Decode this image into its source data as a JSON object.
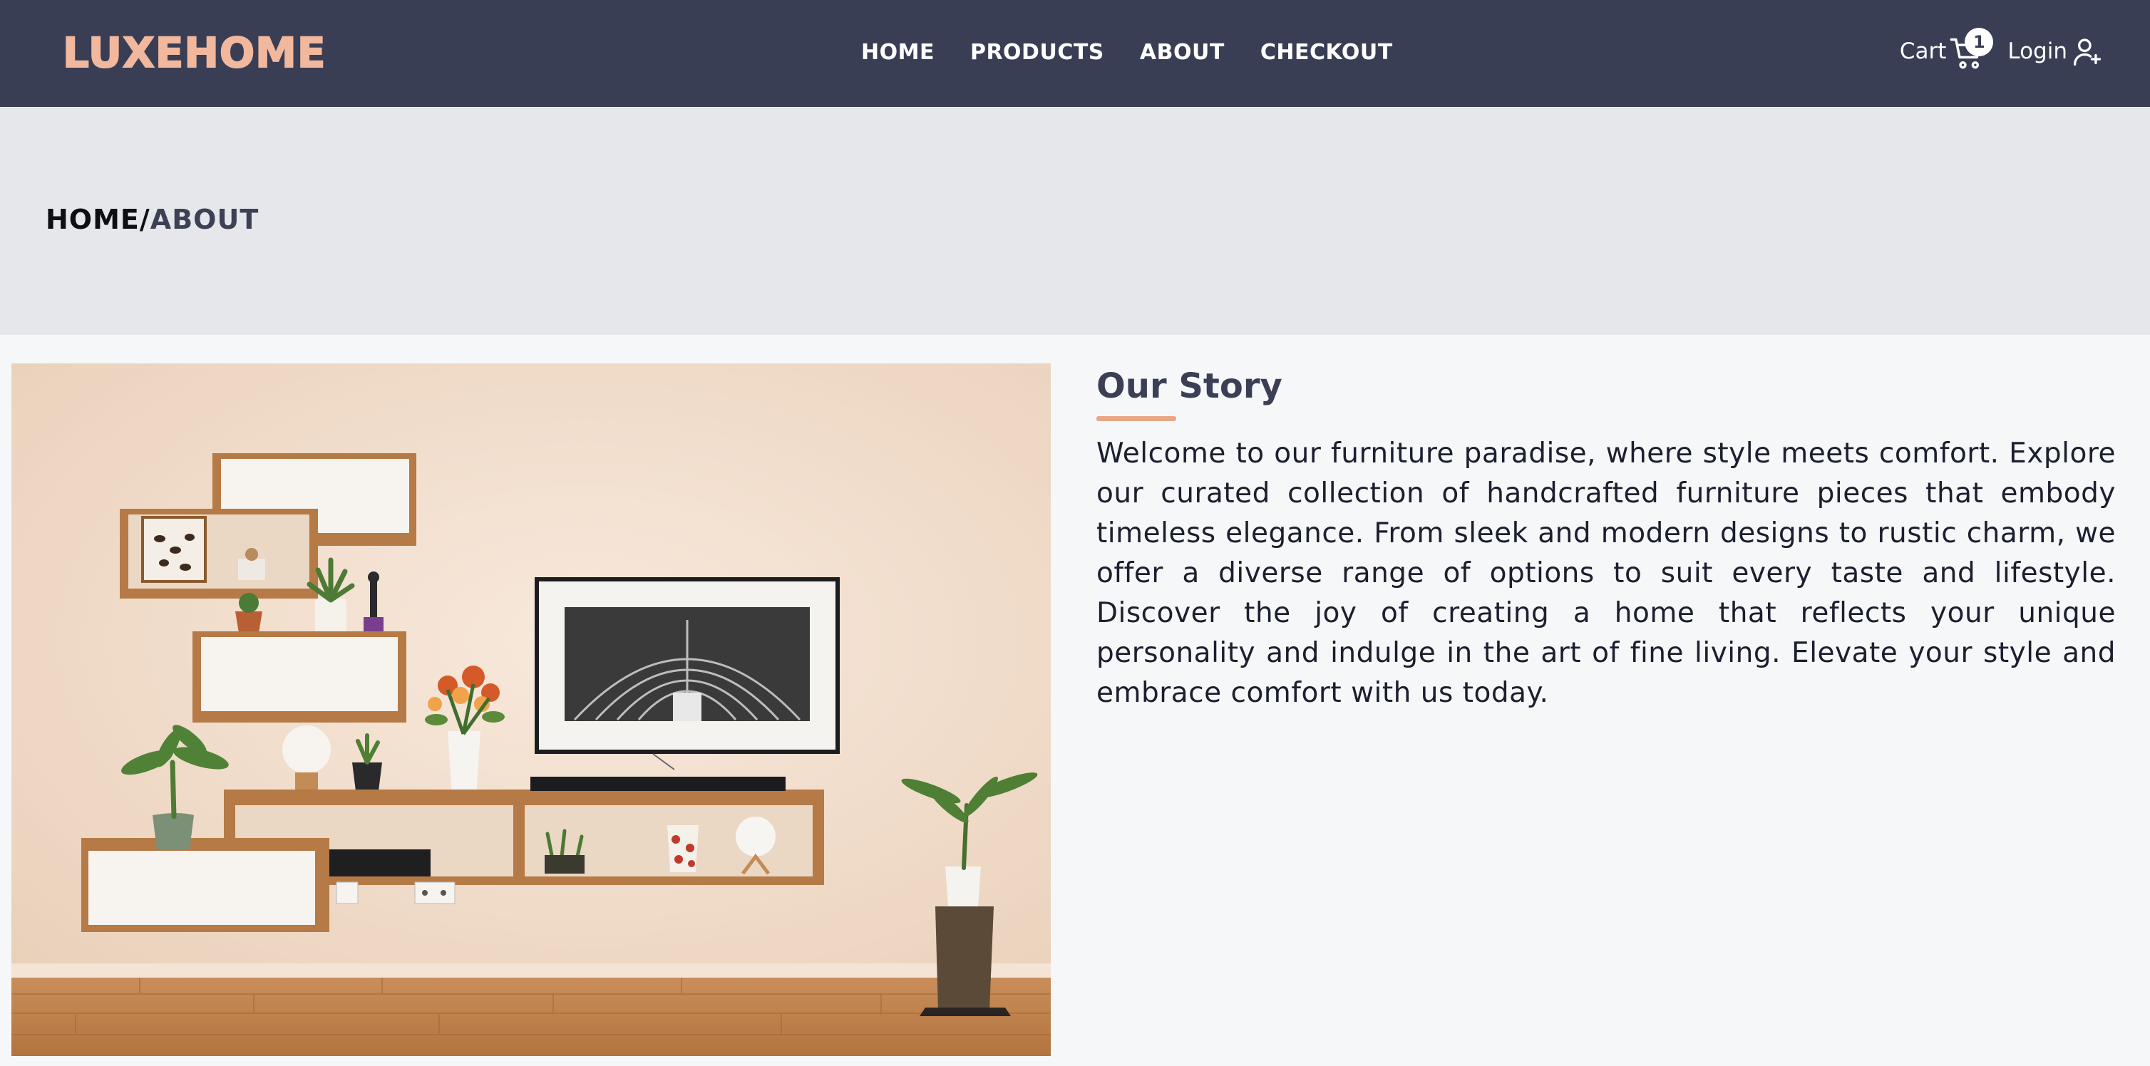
{
  "navbar": {
    "logo": "LUXEHOME",
    "links": [
      {
        "label": "HOME"
      },
      {
        "label": "PRODUCTS"
      },
      {
        "label": "ABOUT"
      },
      {
        "label": "CHECKOUT"
      }
    ],
    "cart_label": "Cart",
    "cart_icon": "cart-icon",
    "cart_count": "1",
    "login_label": "Login",
    "login_icon": "user-plus-icon"
  },
  "breadcrumb": {
    "home": "HOME",
    "separator": "/",
    "current": "ABOUT"
  },
  "story": {
    "title": "Our Story",
    "body": "Welcome to our furniture paradise, where style meets comfort. Explore our curated collection of handcrafted furniture pieces that embody timeless elegance. From sleek and modern designs to rustic charm, we offer a diverse range of options to suit every taste and lifestyle. Discover the joy of creating a home that reflects your unique personality and indulge in the art of fine living. Elevate your style and embrace comfort with us today."
  },
  "colors": {
    "navbar_bg": "#393e55",
    "logo": "#f1b89d",
    "accent_underline": "#e8a785",
    "band_bg": "#e6e7ea",
    "page_bg": "#f6f7f9"
  }
}
